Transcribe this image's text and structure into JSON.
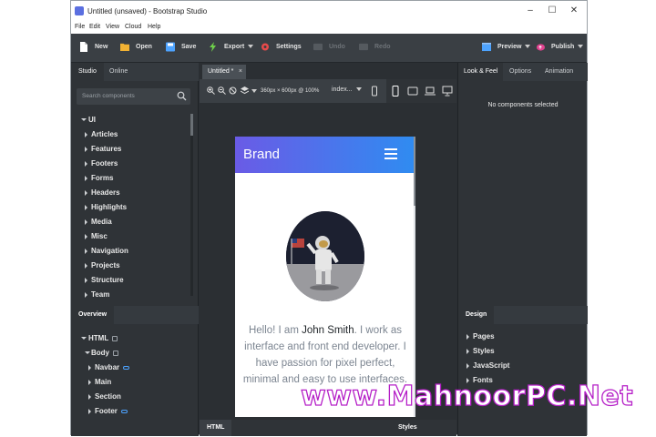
{
  "window": {
    "title": "Untitled (unsaved) - Bootstrap Studio",
    "controls": {
      "minimize": "–",
      "maximize": "☐",
      "close": "✕"
    }
  },
  "menu": [
    "File",
    "Edit",
    "View",
    "Cloud",
    "Help"
  ],
  "toolbar": {
    "new": "New",
    "open": "Open",
    "save": "Save",
    "export": "Export",
    "settings": "Settings",
    "undo": "Undo",
    "redo": "Redo",
    "preview": "Preview",
    "publish": "Publish"
  },
  "left_panel": {
    "tabs": [
      "Studio",
      "Online"
    ],
    "search_placeholder": "Search components",
    "components_root": "UI",
    "components": [
      "Articles",
      "Features",
      "Footers",
      "Forms",
      "Headers",
      "Highlights",
      "Media",
      "Misc",
      "Navigation",
      "Projects",
      "Structure",
      "Team"
    ],
    "overview_tab": "Overview",
    "overview": [
      {
        "label": "HTML",
        "lock": true
      },
      {
        "label": "Body",
        "lock": true
      },
      {
        "label": "Navbar",
        "link": true
      },
      {
        "label": "Main"
      },
      {
        "label": "Section"
      },
      {
        "label": "Footer",
        "link": true
      }
    ]
  },
  "center": {
    "doc_tab": "Untitled *",
    "doc_tab_close": "×",
    "resolution": "360px × 600px @ 100%",
    "page_select": "index...",
    "bottom_tabs": {
      "html": "HTML",
      "styles": "Styles"
    },
    "preview": {
      "brand": "Brand",
      "bio_pre": "Hello! I am ",
      "bio_name": "John Smith",
      "bio_post": ". I work as interface and front end developer. I have passion for pixel perfect, minimal and easy to use interfaces."
    }
  },
  "right_panel": {
    "tabs": [
      "Look & Feel",
      "Options",
      "Animation"
    ],
    "no_selection": "No components selected",
    "design_tab": "Design",
    "design_items": [
      "Pages",
      "Styles",
      "JavaScript",
      "Fonts"
    ]
  },
  "watermark": "www.MahnoorPC.Net",
  "colors": {
    "nav_gradient_start": "#6a5be6",
    "nav_gradient_end": "#2f8cf1",
    "publish_accent": "#e0438f",
    "watermark_outline": "#b51ec7"
  }
}
